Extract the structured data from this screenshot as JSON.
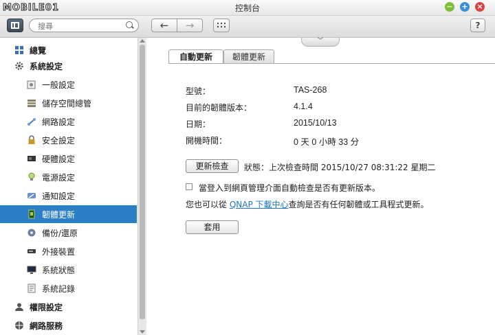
{
  "window": {
    "logo": "MOBILE01",
    "title": "控制台"
  },
  "toolbar": {
    "search_placeholder": "搜尋",
    "back_label": "←",
    "forward_label": "→",
    "help_label": "?"
  },
  "sidebar": {
    "items": [
      {
        "label": "總覽",
        "level": "top",
        "icon": "grid-icon"
      },
      {
        "label": "系統設定",
        "level": "top",
        "icon": "gear-icon"
      },
      {
        "label": "一般設定",
        "level": "sub",
        "icon": "settings-doc-icon"
      },
      {
        "label": "儲存空間總管",
        "level": "sub",
        "icon": "storage-icon"
      },
      {
        "label": "網路設定",
        "level": "sub",
        "icon": "network-icon"
      },
      {
        "label": "安全設定",
        "level": "sub",
        "icon": "lock-icon"
      },
      {
        "label": "硬體設定",
        "level": "sub",
        "icon": "hardware-icon"
      },
      {
        "label": "電源設定",
        "level": "sub",
        "icon": "bulb-icon"
      },
      {
        "label": "通知設定",
        "level": "sub",
        "icon": "notification-icon"
      },
      {
        "label": "韌體更新",
        "level": "sub",
        "icon": "firmware-icon",
        "active": true
      },
      {
        "label": "備份/還原",
        "level": "sub",
        "icon": "backup-icon"
      },
      {
        "label": "外接裝置",
        "level": "sub",
        "icon": "external-device-icon"
      },
      {
        "label": "系統狀態",
        "level": "sub",
        "icon": "monitor-icon"
      },
      {
        "label": "系統記錄",
        "level": "sub",
        "icon": "log-icon"
      },
      {
        "label": "權限設定",
        "level": "top",
        "icon": "user-icon"
      },
      {
        "label": "網路服務",
        "level": "top",
        "icon": "globe-icon"
      }
    ]
  },
  "tabs": [
    {
      "label": "自動更新",
      "active": true
    },
    {
      "label": "韌體更新",
      "active": false
    }
  ],
  "info": [
    {
      "label": "型號：",
      "value": "TAS-268"
    },
    {
      "label": "目前的韌體版本：",
      "value": "4.1.4"
    },
    {
      "label": "日期：",
      "value": "2015/10/13"
    },
    {
      "label": "開機時間：",
      "value": "0 天 0 小時 33 分"
    }
  ],
  "actions": {
    "check_button": "更新檢查",
    "status_text": "狀態：上次檢查時間 2015/10/27 08:31:22 星期二",
    "auto_check_label": "當登入到網頁管理介面自動檢查是否有更新版本。",
    "auto_check_checked": false,
    "note_prefix": "您也可以從",
    "note_link": "QNAP 下載中心",
    "note_suffix": "查詢是否有任何韌體或工具程式更新。",
    "apply_button": "套用"
  },
  "colors": {
    "active_nav": "#2a7fc5",
    "link": "#1e74c2"
  }
}
